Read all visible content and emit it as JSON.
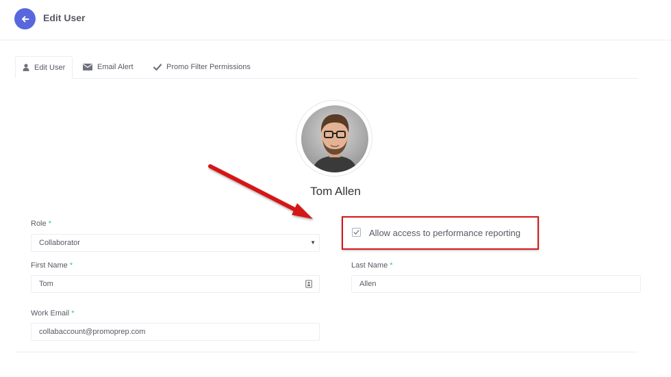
{
  "header": {
    "title": "Edit User"
  },
  "tabs": [
    {
      "label": "Edit User",
      "icon": "user-icon",
      "active": true
    },
    {
      "label": "Email Alert",
      "icon": "envelope-icon",
      "active": false
    },
    {
      "label": "Promo Filter Permissions",
      "icon": "check-icon",
      "active": false
    }
  ],
  "profile": {
    "name": "Tom Allen"
  },
  "form": {
    "role": {
      "label": "Role",
      "required": "*",
      "value": "Collaborator"
    },
    "first_name": {
      "label": "First Name",
      "required": "*",
      "value": "Tom"
    },
    "last_name": {
      "label": "Last Name",
      "required": "*",
      "value": "Allen"
    },
    "work_email": {
      "label": "Work Email",
      "required": "*",
      "value": "collabaccount@promoprep.com"
    },
    "performance_access": {
      "label": "Allow access to performance reporting",
      "checked": true
    }
  },
  "colors": {
    "accent": "#5867dd",
    "required": "#34bfa3",
    "annotation": "#d51717"
  }
}
